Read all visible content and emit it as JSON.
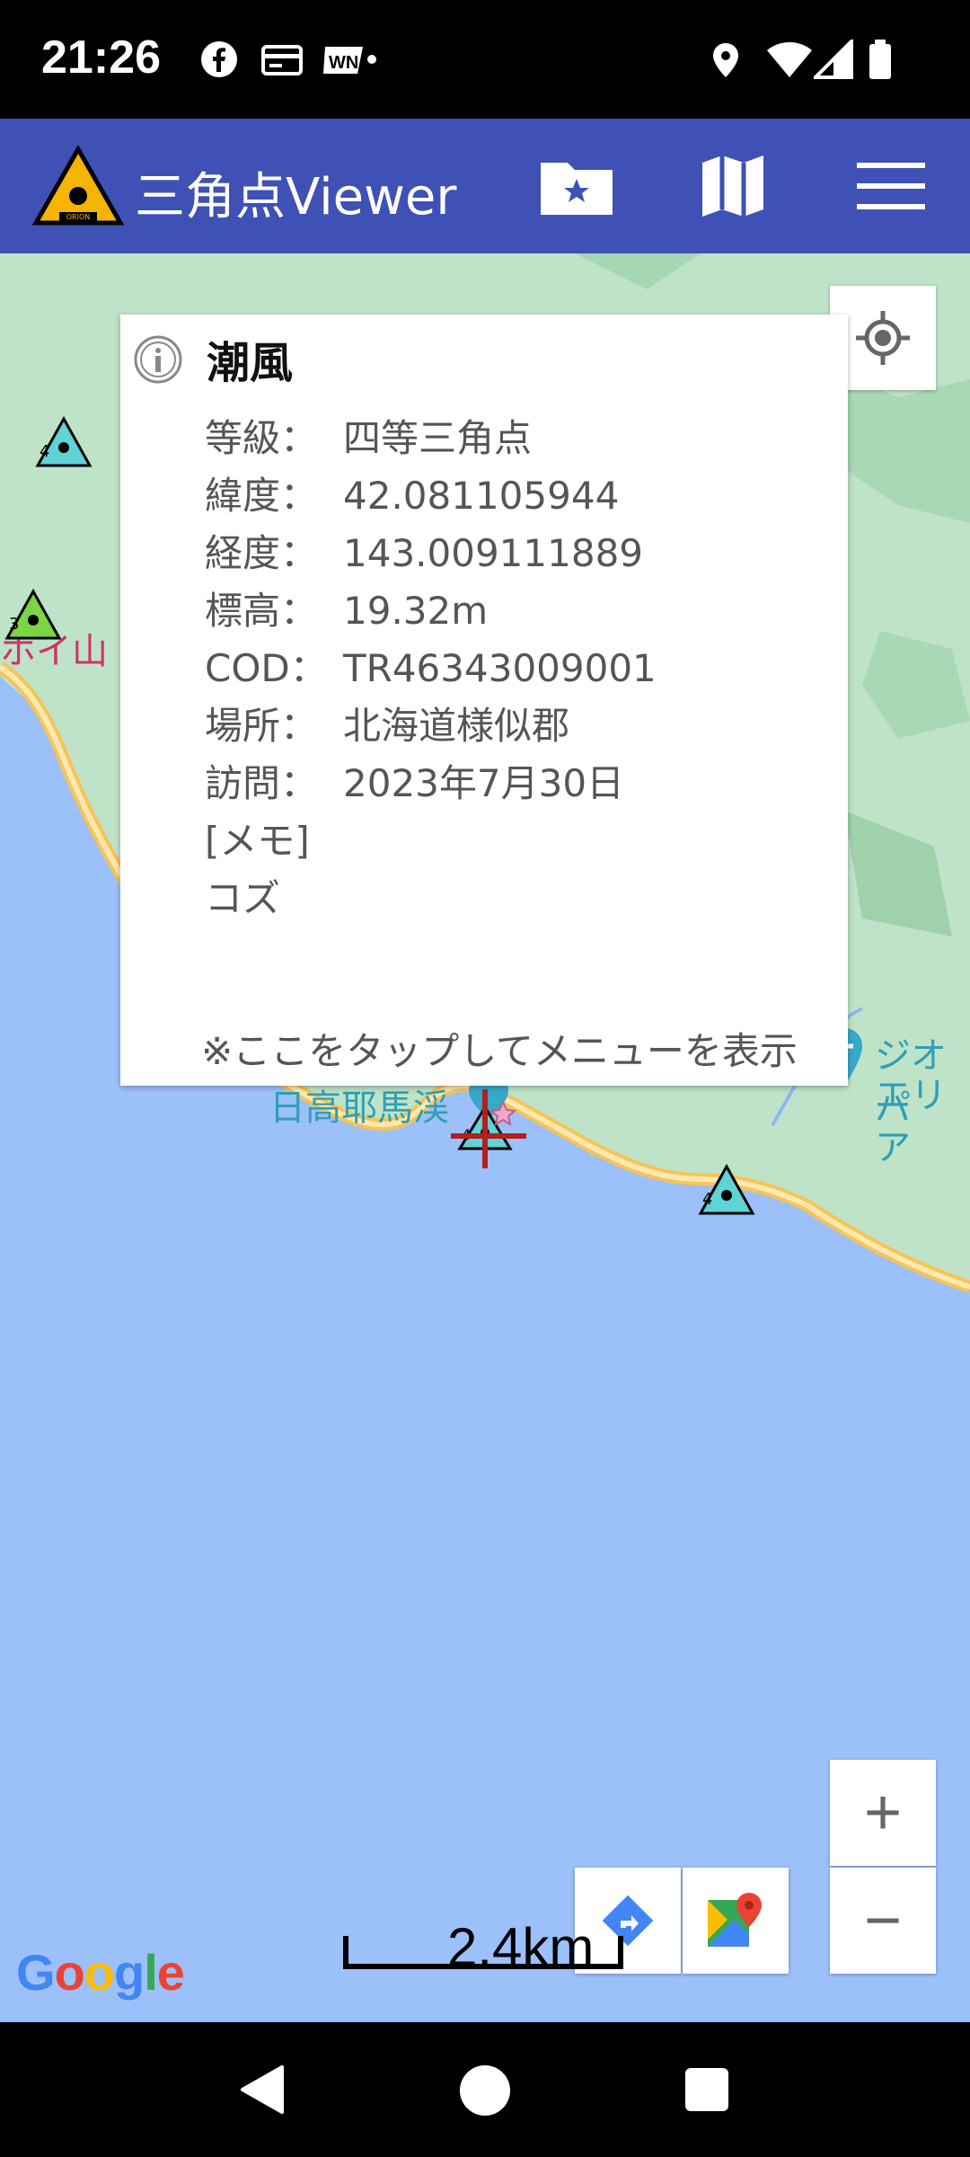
{
  "status_bar": {
    "time": "21:26",
    "icons": [
      "facebook-icon",
      "card-icon",
      "wn-icon",
      "location-icon",
      "wifi-icon",
      "signal-icon",
      "battery-icon"
    ]
  },
  "app_bar": {
    "title": "三角点Viewer",
    "logo_text": "ORION",
    "actions": [
      "favorites-folder-icon",
      "map-icon",
      "menu-icon"
    ],
    "color": "#3f51b5"
  },
  "map": {
    "labels": {
      "place_partial_left": "ホイ山",
      "place_near_marker": "日高耶馬渓",
      "geo_line1": "ジオパ",
      "geo_line2": "エリア"
    },
    "markers": [
      {
        "grade": "4"
      },
      {
        "grade": "3"
      },
      {
        "grade": "4"
      },
      {
        "grade": "4"
      }
    ],
    "scale": "2.4km",
    "attribution": "Google",
    "zoom_in": "+",
    "zoom_out": "−",
    "sea_color": "#9cc0f9",
    "land_color": "#bfe3c8"
  },
  "info_popup": {
    "name": "潮風",
    "rows": [
      {
        "label": "等級：",
        "value": "四等三角点"
      },
      {
        "label": "緯度：",
        "value": "42.081105944"
      },
      {
        "label": "経度：",
        "value": "143.009111889"
      },
      {
        "label": "標高：",
        "value": "19.32m"
      },
      {
        "label": "COD：",
        "value": "TR46343009001"
      },
      {
        "label": "場所：",
        "value": "北海道様似郡"
      },
      {
        "label": "訪問：",
        "value": "2023年7月30日"
      }
    ],
    "memo_label": "[メモ]",
    "memo_text": "コズ",
    "hint": "※ここをタップしてメニューを表示"
  }
}
